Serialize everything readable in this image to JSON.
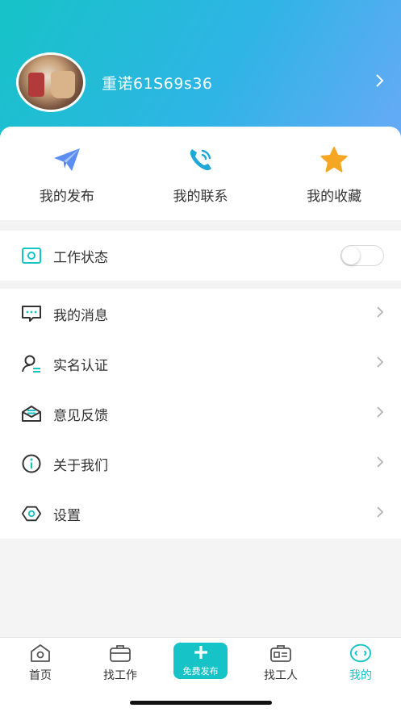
{
  "profile": {
    "username": "重诺61S69s36"
  },
  "quick_actions": [
    {
      "label": "我的发布",
      "icon": "paper-plane-icon"
    },
    {
      "label": "我的联系",
      "icon": "phone-icon"
    },
    {
      "label": "我的收藏",
      "icon": "star-icon"
    }
  ],
  "work_status": {
    "label": "工作状态",
    "enabled": false
  },
  "menu": [
    {
      "label": "我的消息",
      "icon": "message-icon"
    },
    {
      "label": "实名认证",
      "icon": "user-verify-icon"
    },
    {
      "label": "意见反馈",
      "icon": "feedback-icon"
    },
    {
      "label": "关于我们",
      "icon": "info-icon"
    },
    {
      "label": "设置",
      "icon": "settings-icon"
    }
  ],
  "tabbar": {
    "home": "首页",
    "find_job": "找工作",
    "publish": "免费发布",
    "find_worker": "找工人",
    "mine": "我的"
  },
  "colors": {
    "accent": "#16c3c7",
    "header_gradient": [
      "#16c3c7",
      "#2fb4e6",
      "#6aa9f7"
    ],
    "plane": "#5b8ef0",
    "star": "#f5a623"
  }
}
